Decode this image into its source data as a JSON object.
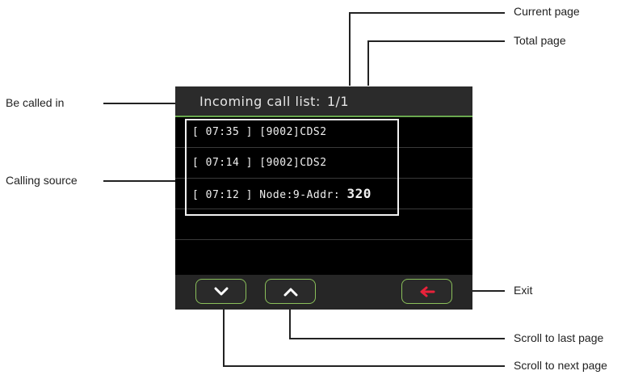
{
  "screen": {
    "title": "Incoming call list:",
    "page_indicator": "1/1",
    "calls": [
      {
        "time": "[ 07:35 ]",
        "source": "[9002]CDS2",
        "extra": ""
      },
      {
        "time": "[ 07:14 ]",
        "source": "[9002]CDS2",
        "extra": ""
      },
      {
        "time": "[ 07:12 ]",
        "source": "Node:9-Addr:",
        "extra": "320"
      }
    ],
    "buttons": {
      "down_icon": "chevron-down-icon",
      "up_icon": "chevron-up-icon",
      "exit_icon": "arrow-left-icon",
      "exit_color": "#e8223a"
    }
  },
  "callouts": {
    "current_page": "Current page",
    "total_page": "Total page",
    "be_called_in": "Be called in",
    "calling_source": "Calling source",
    "exit": "Exit",
    "scroll_last": "Scroll to last page",
    "scroll_next": "Scroll to next page"
  },
  "colors": {
    "accent_green": "#6aa84f",
    "button_border": "#8abf5a"
  }
}
